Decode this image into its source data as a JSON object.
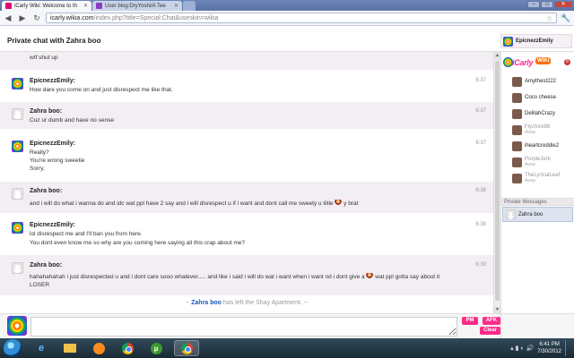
{
  "browser": {
    "tabs": [
      {
        "label": "iCarly Wiki: Welcome to th",
        "active": true
      },
      {
        "label": "User blog:DryYoshi/A Tee",
        "active": false
      }
    ],
    "url_host": "icarly.wikia.com",
    "url_path": "/index.php?title=Special:Chat&useskin=wikia",
    "window_buttons": {
      "minimize": "–",
      "maximize": "□",
      "close": "✕"
    }
  },
  "chat": {
    "title": "Private chat with Zahra boo",
    "current_user": "EpicnezzEmily",
    "messages": [
      {
        "name": "",
        "time": "",
        "lines": [
          "wtf shut up"
        ],
        "avatar": "gray"
      },
      {
        "name": "EpicnezzEmily:",
        "time": "6:37",
        "lines": [
          "How dare you come on and just disrespect me like that."
        ],
        "avatar": "color"
      },
      {
        "name": "Zahra boo:",
        "time": "6:37",
        "lines": [
          "Cuz ur dumb and have no sense"
        ],
        "avatar": "gray"
      },
      {
        "name": "EpicnezzEmily:",
        "time": "6:37",
        "lines": [
          "Really?",
          "You're wrong sweetie",
          "Sorry."
        ],
        "avatar": "color"
      },
      {
        "name": "Zahra boo:",
        "time": "6:38",
        "lines": [
          "and i will do what i wanna do and idc wat ppl have 2 say and i will disrespect u if i want and dont call me sweety u liitle",
          "y brat"
        ],
        "avatar": "gray"
      },
      {
        "name": "EpicnezzEmily:",
        "time": "6:38",
        "lines": [
          "lol disrespect me and I'll ban you from here.",
          "You dont even know me so why are you coming here saying all this crap about me?"
        ],
        "avatar": "color"
      },
      {
        "name": "Zahra boo:",
        "time": "6:39",
        "lines": [
          "hahahahahah i just disrespected u and i dont care sooo whatever..... and like i said i will do wat i want when i want nd i dont give a",
          "wat ppl gotta say about it",
          "LOSER"
        ],
        "avatar": "gray"
      }
    ],
    "system": {
      "prefix": "~",
      "who": "Zahra boo",
      "text": "has left the Shay Apartment.",
      "suffix": "~"
    }
  },
  "sidebar": {
    "logo": "iCarly",
    "logo_badge": "WIKI",
    "counter": "8",
    "users": [
      {
        "name": "Amythest222",
        "status": ""
      },
      {
        "name": "Coco cheese",
        "status": ""
      },
      {
        "name": "DelilahCrazy",
        "status": ""
      },
      {
        "name": "Flychick88",
        "status": "Away"
      },
      {
        "name": "iheartcreddie2",
        "status": ""
      },
      {
        "name": "PurpleJerk",
        "status": "Away"
      },
      {
        "name": "TheLyricalLeaf",
        "status": "Away"
      }
    ],
    "private_messages_label": "Private Messages",
    "private_messages": [
      {
        "name": "Zahra boo"
      }
    ]
  },
  "input": {
    "value": "",
    "pm_label": "PM",
    "afk_label": "AFK",
    "clear_label": "Clear"
  },
  "taskbar": {
    "time": "6:41 PM",
    "date": "7/30/2012"
  }
}
